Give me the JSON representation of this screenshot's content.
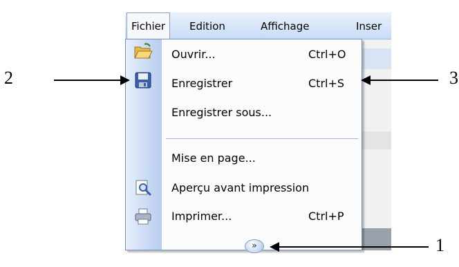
{
  "menubar": {
    "items": [
      {
        "label": "Fichier",
        "active": true
      },
      {
        "label": "Edition"
      },
      {
        "label": "Affichage"
      },
      {
        "label": "Inser"
      }
    ]
  },
  "file_menu": {
    "items": [
      {
        "label": "Ouvrir...",
        "shortcut": "Ctrl+O",
        "icon": "open-folder-icon"
      },
      {
        "label": "Enregistrer",
        "shortcut": "Ctrl+S",
        "icon": "save-icon"
      },
      {
        "label": "Enregistrer sous...",
        "shortcut": "",
        "icon": ""
      },
      {
        "label": "Mise en page...",
        "shortcut": "",
        "icon": ""
      },
      {
        "label": "Aperçu avant impression",
        "shortcut": "",
        "icon": "print-preview-icon"
      },
      {
        "label": "Imprimer...",
        "shortcut": "Ctrl+P",
        "icon": "printer-icon"
      }
    ],
    "expand_glyph": "»"
  },
  "annotations": {
    "label_1": "1",
    "label_2": "2",
    "label_3": "3"
  },
  "colors": {
    "menubar_bg": "#c8dcf6",
    "icon_column": "#b6cdef",
    "border": "#6f8fbf"
  }
}
